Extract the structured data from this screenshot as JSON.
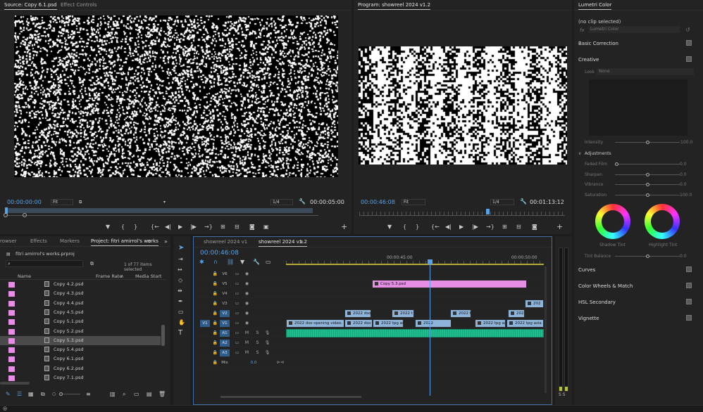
{
  "source": {
    "tabs": [
      "Source: Copy 6.1.psd",
      "Effect Controls"
    ],
    "timecode": "00:00:00:00",
    "fit": "Fit",
    "res": "1/4",
    "duration": "00:00:05:00"
  },
  "program": {
    "tab": "Program: showreel 2024 v1.2",
    "timecode": "00:00:46:08",
    "fit": "Fit",
    "res": "1/4",
    "duration": "00:01:13:12"
  },
  "lumetri": {
    "tab": "Lumetri Color",
    "clip": "(no clip selected)",
    "fx": "fx",
    "effect": "Lumetri Color",
    "sections": {
      "basic": "Basic Correction",
      "creative": "Creative",
      "curves": "Curves",
      "wheels": "Color Wheels & Match",
      "hsl": "HSL Secondary",
      "vignette": "Vignette"
    },
    "look_label": "Look",
    "look_value": "None",
    "intensity": "Intensity",
    "intensity_val": "100.0",
    "adjustments": "Adjustments",
    "sliders": [
      {
        "label": "Faded Film",
        "value": "0.0",
        "frac": 0
      },
      {
        "label": "Sharpen",
        "value": "0.0",
        "frac": 0.5
      },
      {
        "label": "Vibrance",
        "value": "0.0",
        "frac": 0.5
      },
      {
        "label": "Saturation",
        "value": "100.0",
        "frac": 0.5
      }
    ],
    "shadow": "Shadow Tint",
    "highlight": "Highlight Tint",
    "tint_balance": "Tint Balance",
    "tint_val": "0.0"
  },
  "project": {
    "tabs": [
      "rowser",
      "Effects",
      "Markers",
      "Project: fitri amirrol's works"
    ],
    "file": "fitri amirrol's works.prproj",
    "count": "1 of 77 items selected",
    "cols": {
      "name": "Name",
      "rate": "Frame Rate",
      "start": "Media Start"
    },
    "items": [
      "Copy 4.2.psd",
      "Copy 4.3.psd",
      "Copy 4.4.psd",
      "Copy 4.5.psd",
      "Copy 5.1.psd",
      "Copy 5.2.psd",
      "Copy 5.3.psd",
      "Copy 5.4.psd",
      "Copy 6.1.psd",
      "Copy 6.2.psd",
      "Copy 7.1.psd"
    ],
    "selected_index": 6
  },
  "timeline": {
    "tabs": [
      "showreel 2024 v1",
      "showreel 2024 v1.2"
    ],
    "timecode": "00:00:46:08",
    "ruler": [
      "00:00:45:00",
      "00:00:50:00"
    ],
    "video_tracks": [
      "V6",
      "V5",
      "V4",
      "V3",
      "V2",
      "V1"
    ],
    "audio_tracks": [
      "A1",
      "A2",
      "A3"
    ],
    "source_patch": "V1",
    "mix": "Mix",
    "mix_val": "0.0",
    "meter": "S S",
    "clips": {
      "c1": "Copy 5.3.psd",
      "c2": "2022 dso",
      "c3": "2022 t",
      "c4": "2022 t",
      "c5": "2022 dso opening video.",
      "c6": "2022 dso",
      "c7": "2022 tpg as",
      "c8": "2022",
      "c9": "2022 tpg asia",
      "c10": "2022 tpg asia r",
      "c11": "202"
    }
  },
  "colors": {
    "accent": "#5aa2e8",
    "pink": "#e68ee6",
    "audio": "#1fbf8f",
    "clip_blue": "#8fb4d9"
  }
}
